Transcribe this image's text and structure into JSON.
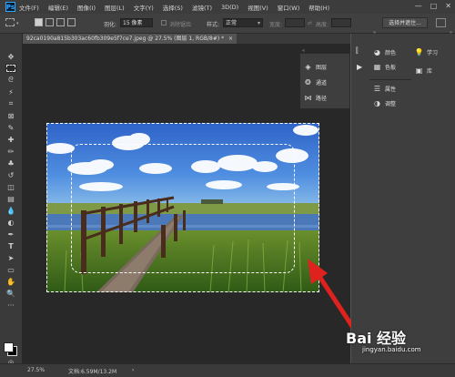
{
  "app": {
    "logo": "Ps"
  },
  "menu": [
    "文件(F)",
    "编辑(E)",
    "图像(I)",
    "图层(L)",
    "文字(Y)",
    "选择(S)",
    "滤镜(T)",
    "3D(D)",
    "视图(V)",
    "窗口(W)",
    "帮助(H)"
  ],
  "window_controls": {
    "minimize": "—",
    "maximize": "□",
    "close": "✕"
  },
  "options": {
    "feather_label": "羽化:",
    "feather_value": "15 像素",
    "antialias_label": "消除锯齿",
    "style_label": "样式:",
    "style_value": "正常",
    "width_label": "宽度:",
    "height_label": "高度:",
    "select_mask_button": "选择并遮住..."
  },
  "document": {
    "tab_title": "92ca0190a815b303ac60fb309e5f7ce7.jpeg @ 27.5% (图层 1, RGB/8#) *",
    "close": "×"
  },
  "panels": {
    "floating": [
      {
        "icon": "layers-icon",
        "label": "图层"
      },
      {
        "icon": "channels-icon",
        "label": "通道"
      },
      {
        "icon": "paths-icon",
        "label": "路径"
      }
    ],
    "col2": [
      {
        "icon": "color-icon",
        "label": "颜色"
      },
      {
        "icon": "swatches-icon",
        "label": "色板"
      },
      {
        "icon": "properties-icon",
        "label": "属性"
      },
      {
        "icon": "adjustments-icon",
        "label": "调整"
      }
    ],
    "col3": [
      {
        "icon": "learn-icon",
        "label": "学习"
      },
      {
        "icon": "libraries-icon",
        "label": "库"
      }
    ]
  },
  "status": {
    "zoom": "27.5%",
    "doc_info": "文档:6.59M/13.2M",
    "arrow": "›"
  },
  "watermark": {
    "brand": "Bai 经验",
    "url": "jingyan.baidu.com"
  },
  "colors": {
    "annotation_arrow": "#e0221f",
    "ps_blue": "#31a8ff"
  }
}
